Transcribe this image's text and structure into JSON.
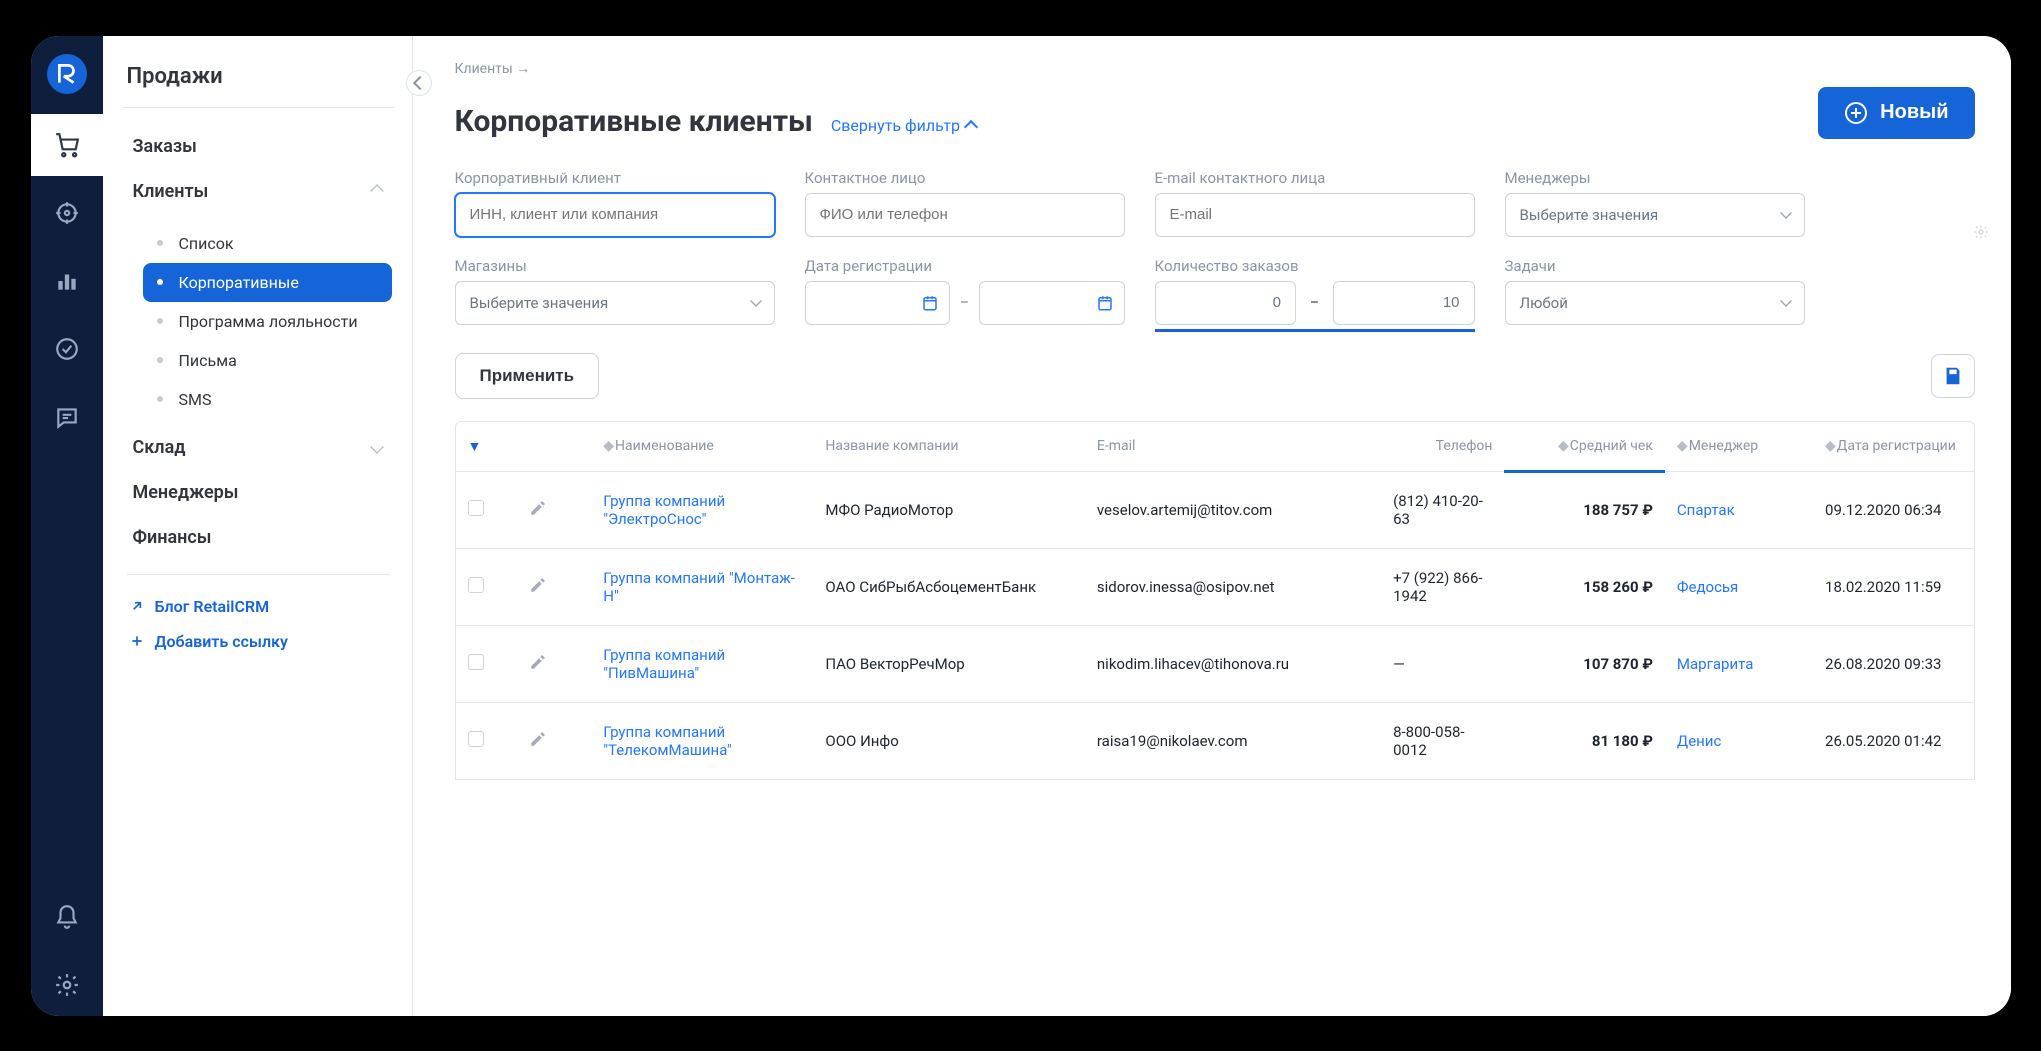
{
  "sidebar": {
    "section_title": "Продажи",
    "items": [
      {
        "label": "Заказы",
        "state": "closed"
      },
      {
        "label": "Клиенты",
        "state": "open"
      },
      {
        "label": "Склад",
        "state": "closed"
      },
      {
        "label": "Менеджеры",
        "state": "closed"
      },
      {
        "label": "Финансы",
        "state": "closed"
      }
    ],
    "clients_sub": [
      {
        "label": "Список"
      },
      {
        "label": "Корпоративные",
        "active": true
      },
      {
        "label": "Программа лояльности"
      },
      {
        "label": "Письма"
      },
      {
        "label": "SMS"
      }
    ],
    "blog_link": "Блог RetailCRM",
    "add_link": "Добавить ссылку"
  },
  "breadcrumb": "Клиенты →",
  "page_title": "Корпоративные клиенты",
  "collapse_filter": "Свернуть фильтр",
  "new_button": "Новый",
  "filters": {
    "client": {
      "label": "Корпоративный клиент",
      "placeholder": "ИНН, клиент или компания"
    },
    "contact": {
      "label": "Контактное лицо",
      "placeholder": "ФИО или телефон"
    },
    "email": {
      "label": "E-mail контактного лица",
      "placeholder": "E-mail"
    },
    "managers": {
      "label": "Менеджеры",
      "placeholder": "Выберите значения"
    },
    "stores": {
      "label": "Магазины",
      "placeholder": "Выберите значения"
    },
    "reg_date": {
      "label": "Дата регистрации"
    },
    "order_count": {
      "label": "Количество заказов",
      "from": "0",
      "to": "10"
    },
    "tasks": {
      "label": "Задачи",
      "placeholder": "Любой"
    }
  },
  "apply_button": "Применить",
  "table": {
    "headers": {
      "name": "Наименование",
      "company": "Название компании",
      "email": "E-mail",
      "phone": "Телефон",
      "avg": "Средний чек",
      "manager": "Менеджер",
      "reg": "Дата регистрации"
    },
    "rows": [
      {
        "name": "Группа компаний \"ЭлектроСнос\"",
        "company": "МФО РадиоМотор",
        "email": "veselov.artemij@titov.com",
        "phone": "(812) 410-20-63",
        "avg": "188 757 ₽",
        "manager": "Спартак",
        "reg": "09.12.2020 06:34"
      },
      {
        "name": "Группа компаний \"Монтаж-Н\"",
        "company": "ОАО СибРыбАсбоцементБанк",
        "email": "sidorov.inessa@osipov.net",
        "phone": "+7 (922) 866-1942",
        "avg": "158 260 ₽",
        "manager": "Федосья",
        "reg": "18.02.2020 11:59"
      },
      {
        "name": "Группа компаний \"ПивМашина\"",
        "company": "ПАО ВекторРечМор",
        "email": "nikodim.lihacev@tihonova.ru",
        "phone": "—",
        "avg": "107 870 ₽",
        "manager": "Маргарита",
        "reg": "26.08.2020 09:33"
      },
      {
        "name": "Группа компаний \"ТелекомМашина\"",
        "company": "ООО Инфо",
        "email": "raisa19@nikolaev.com",
        "phone": "8-800-058-0012",
        "avg": "81 180 ₽",
        "manager": "Денис",
        "reg": "26.05.2020 01:42"
      }
    ]
  }
}
